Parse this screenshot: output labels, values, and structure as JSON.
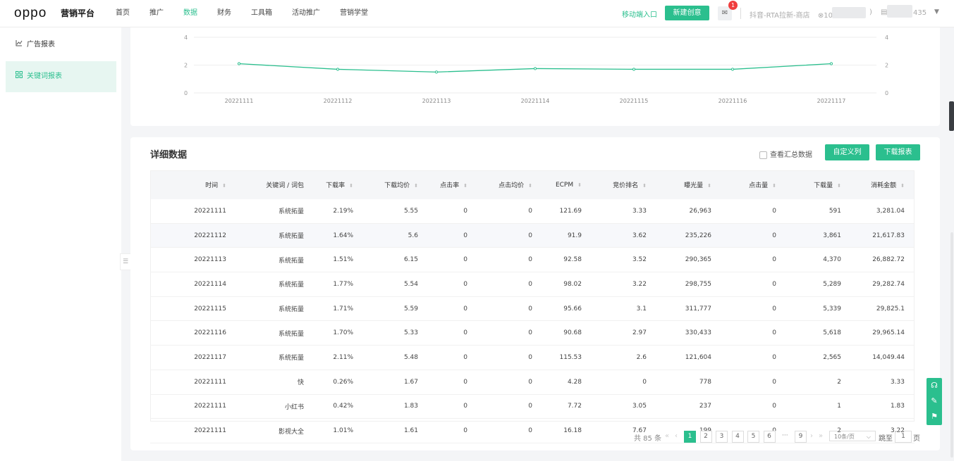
{
  "header": {
    "logo": "oppo",
    "brand": "营销平台",
    "nav": [
      "首页",
      "推广",
      "数据",
      "财务",
      "工具箱",
      "活动推广",
      "营销学堂"
    ],
    "active_nav": 2,
    "mobile_link": "移动端入口",
    "new_button": "新建创意",
    "badge_count": "1",
    "account": "抖音-RTA拉新-商店",
    "user_id_prefix": "10",
    "user_id_suffix": "435"
  },
  "sidebar": {
    "items": [
      {
        "label": "广告报表",
        "icon": "chart-line-icon"
      },
      {
        "label": "关键词报表",
        "icon": "grid-icon"
      }
    ],
    "active": 1
  },
  "chart_data": {
    "type": "line",
    "x": [
      "20221111",
      "20221112",
      "20221113",
      "20221114",
      "20221115",
      "20221116",
      "20221117"
    ],
    "series": [
      {
        "values": [
          2.1,
          1.7,
          1.5,
          1.75,
          1.7,
          1.7,
          2.1
        ]
      }
    ],
    "yticks": [
      "0",
      "2",
      "4"
    ],
    "ylim": [
      0,
      4
    ],
    "color": "#2bbf8e",
    "grid": true
  },
  "detail": {
    "title": "详细数据",
    "summary_checkbox": "查看汇总数据",
    "custom_button": "自定义列",
    "download_button": "下载报表",
    "columns": [
      "时间",
      "关键词 / 词包",
      "下载率",
      "下载均价",
      "点击率",
      "点击均价",
      "ECPM",
      "竞价排名",
      "曝光量",
      "点击量",
      "下载量",
      "消耗金额"
    ],
    "rows": [
      [
        "20221111",
        "系统拓量",
        "2.19%",
        "5.55",
        "0",
        "0",
        "121.69",
        "3.33",
        "26,963",
        "0",
        "591",
        "3,281.04"
      ],
      [
        "20221112",
        "系统拓量",
        "1.64%",
        "5.6",
        "0",
        "0",
        "91.9",
        "3.62",
        "235,226",
        "0",
        "3,861",
        "21,617.83"
      ],
      [
        "20221113",
        "系统拓量",
        "1.51%",
        "6.15",
        "0",
        "0",
        "92.58",
        "3.52",
        "290,365",
        "0",
        "4,370",
        "26,882.72"
      ],
      [
        "20221114",
        "系统拓量",
        "1.77%",
        "5.54",
        "0",
        "0",
        "98.02",
        "3.22",
        "298,755",
        "0",
        "5,289",
        "29,282.74"
      ],
      [
        "20221115",
        "系统拓量",
        "1.71%",
        "5.59",
        "0",
        "0",
        "95.66",
        "3.1",
        "311,777",
        "0",
        "5,339",
        "29,825.1"
      ],
      [
        "20221116",
        "系统拓量",
        "1.70%",
        "5.33",
        "0",
        "0",
        "90.68",
        "2.97",
        "330,433",
        "0",
        "5,618",
        "29,965.14"
      ],
      [
        "20221117",
        "系统拓量",
        "2.11%",
        "5.48",
        "0",
        "0",
        "115.53",
        "2.6",
        "121,604",
        "0",
        "2,565",
        "14,049.44"
      ],
      [
        "20221111",
        "快",
        "0.26%",
        "1.67",
        "0",
        "0",
        "4.28",
        "0",
        "778",
        "0",
        "2",
        "3.33"
      ],
      [
        "20221111",
        "小红书",
        "0.42%",
        "1.83",
        "0",
        "0",
        "7.72",
        "3.05",
        "237",
        "0",
        "1",
        "1.83"
      ],
      [
        "20221111",
        "影视大全",
        "1.01%",
        "1.61",
        "0",
        "0",
        "16.18",
        "7.67",
        "199",
        "0",
        "2",
        "3.22"
      ]
    ]
  },
  "pagination": {
    "total": "共 85 条",
    "pages": [
      "1",
      "2",
      "3",
      "4",
      "5",
      "6"
    ],
    "ellipsis": "···",
    "last": "9",
    "page_size": "10条/页",
    "jump_label": "跳至",
    "jump_value": "1",
    "page_unit": "页"
  }
}
